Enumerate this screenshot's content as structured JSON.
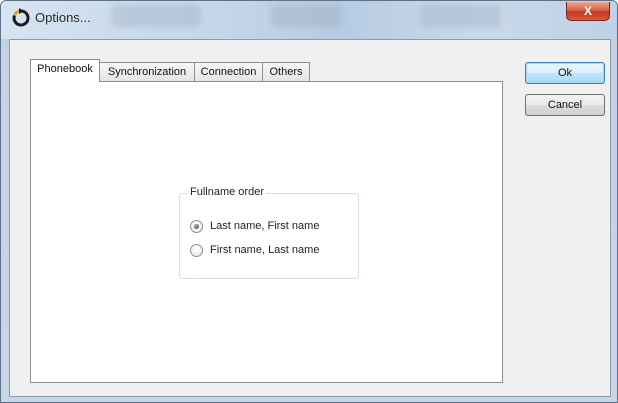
{
  "window": {
    "title": "Options...",
    "close_glyph": "X",
    "icon": "refresh-icon"
  },
  "tabs": [
    {
      "label": "Phonebook",
      "active": true
    },
    {
      "label": "Synchronization",
      "active": false
    },
    {
      "label": "Connection",
      "active": false
    },
    {
      "label": "Others",
      "active": false
    }
  ],
  "fullname_order": {
    "group_label": "Fullname order",
    "options": [
      {
        "label": "Last name, First name",
        "checked": true
      },
      {
        "label": "First name, Last name",
        "checked": false
      }
    ]
  },
  "buttons": {
    "ok_label": "Ok",
    "cancel_label": "Cancel"
  },
  "colors": {
    "close_button": "#c2361e",
    "icon_orange": "#e8a21b",
    "icon_dark": "#1d1d1d"
  }
}
